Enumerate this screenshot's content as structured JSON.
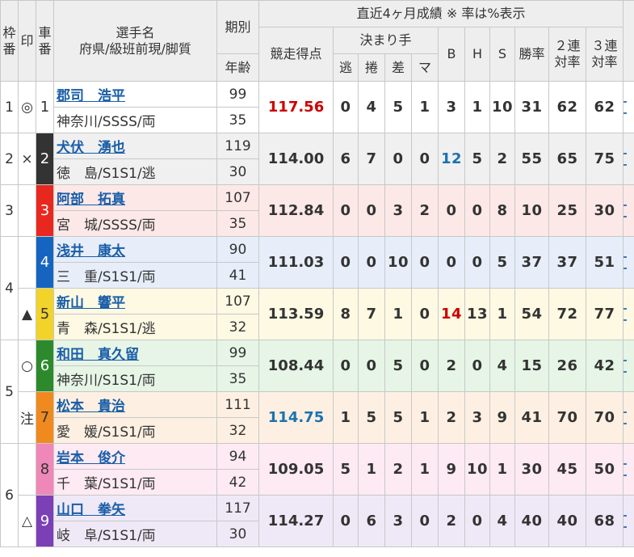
{
  "header": {
    "waku": "枠番",
    "mark": "印",
    "car": "車番",
    "name_line1": "選手名",
    "name_line2": "府県/級班前現/脚質",
    "term": "期別",
    "age": "年齢",
    "recent": "直近4ヶ月成績 ※ 率は%表示",
    "score": "競走得点",
    "kimarite": "決まり手",
    "nige": "逃",
    "makuri": "捲",
    "sashi": "差",
    "mark_col": "マ",
    "b": "B",
    "h": "H",
    "s": "S",
    "win_rate": "勝率",
    "rate2_l1": "２連",
    "rate2_l2": "対率",
    "rate3_l1": "３連",
    "rate3_l2": "対率"
  },
  "colors": {
    "row_bg": [
      "#ffffff",
      "#f0f0f0",
      "#fde8e8",
      "#e7eefa",
      "#fdf9e3",
      "#e6f5e6",
      "#fdf0e2",
      "#fdeaf3",
      "#efe9f7"
    ],
    "car_bg": [
      "#ffffff",
      "#333333",
      "#e8281e",
      "#1565c0",
      "#f2d32a",
      "#2c8a2c",
      "#f08a1e",
      "#ef88b8",
      "#7b3fb6"
    ],
    "car_fg": [
      "#333333",
      "#ffffff",
      "#ffffff",
      "#ffffff",
      "#333333",
      "#ffffff",
      "#333333",
      "#333333",
      "#ffffff"
    ],
    "score_red": "#cc0000",
    "score_blue": "#1a73b0",
    "link": "#1a5ea8"
  },
  "waku": [
    {
      "label": "1",
      "span": 1
    },
    {
      "label": "2",
      "span": 1
    },
    {
      "label": "3",
      "span": 1
    },
    {
      "label": "4",
      "span": 2
    },
    {
      "label": "5",
      "span": 2
    },
    {
      "label": "6",
      "span": 2
    }
  ],
  "riders": [
    {
      "mark": "◎",
      "car": "1",
      "name": "郡司　浩平",
      "region": "神奈川/SSSS/両",
      "term": "99",
      "age": "35",
      "score": "117.56",
      "score_color": "red",
      "nige": "0",
      "makuri": "4",
      "sashi": "5",
      "ma": "1",
      "b": "3",
      "b_color": "",
      "h": "1",
      "s": "10",
      "win": "31",
      "r2": "62",
      "r3": "62"
    },
    {
      "mark": "×",
      "car": "2",
      "name": "犬伏　湧也",
      "region": "徳　島/S1S1/逃",
      "term": "119",
      "age": "30",
      "score": "114.00",
      "score_color": "",
      "nige": "6",
      "makuri": "7",
      "sashi": "0",
      "ma": "0",
      "b": "12",
      "b_color": "blue",
      "h": "5",
      "s": "2",
      "win": "55",
      "r2": "65",
      "r3": "75"
    },
    {
      "mark": "",
      "car": "3",
      "name": "阿部　拓真",
      "region": "宮　城/SSSS/両",
      "term": "107",
      "age": "35",
      "score": "112.84",
      "score_color": "",
      "nige": "0",
      "makuri": "0",
      "sashi": "3",
      "ma": "2",
      "b": "0",
      "b_color": "",
      "h": "0",
      "s": "8",
      "win": "10",
      "r2": "25",
      "r3": "30"
    },
    {
      "mark": "",
      "car": "4",
      "name": "浅井　康太",
      "region": "三　重/S1S1/両",
      "term": "90",
      "age": "41",
      "score": "111.03",
      "score_color": "",
      "nige": "0",
      "makuri": "0",
      "sashi": "10",
      "ma": "0",
      "b": "0",
      "b_color": "",
      "h": "0",
      "s": "5",
      "win": "37",
      "r2": "37",
      "r3": "51"
    },
    {
      "mark": "▲",
      "car": "5",
      "name": "新山　響平",
      "region": "青　森/S1S1/逃",
      "term": "107",
      "age": "32",
      "score": "113.59",
      "score_color": "",
      "nige": "8",
      "makuri": "7",
      "sashi": "1",
      "ma": "0",
      "b": "14",
      "b_color": "red",
      "h": "13",
      "s": "1",
      "win": "54",
      "r2": "72",
      "r3": "77"
    },
    {
      "mark": "○",
      "car": "6",
      "name": "和田　真久留",
      "region": "神奈川/S1S1/両",
      "term": "99",
      "age": "35",
      "score": "108.44",
      "score_color": "",
      "nige": "0",
      "makuri": "0",
      "sashi": "5",
      "ma": "0",
      "b": "2",
      "b_color": "",
      "h": "0",
      "s": "4",
      "win": "15",
      "r2": "26",
      "r3": "42"
    },
    {
      "mark": "注",
      "car": "7",
      "name": "松本　貴治",
      "region": "愛　媛/S1S1/両",
      "term": "111",
      "age": "32",
      "score": "114.75",
      "score_color": "blue",
      "nige": "1",
      "makuri": "5",
      "sashi": "5",
      "ma": "1",
      "b": "2",
      "b_color": "",
      "h": "3",
      "s": "9",
      "win": "41",
      "r2": "70",
      "r3": "70"
    },
    {
      "mark": "",
      "car": "8",
      "name": "岩本　俊介",
      "region": "千　葉/S1S1/両",
      "term": "94",
      "age": "42",
      "score": "109.05",
      "score_color": "",
      "nige": "5",
      "makuri": "1",
      "sashi": "2",
      "ma": "1",
      "b": "9",
      "b_color": "",
      "h": "10",
      "s": "1",
      "win": "30",
      "r2": "45",
      "r3": "50"
    },
    {
      "mark": "△",
      "car": "9",
      "name": "山口　拳矢",
      "region": "岐　阜/S1S1/両",
      "term": "117",
      "age": "30",
      "score": "114.27",
      "score_color": "",
      "nige": "0",
      "makuri": "6",
      "sashi": "3",
      "ma": "0",
      "b": "2",
      "b_color": "",
      "h": "0",
      "s": "4",
      "win": "40",
      "r2": "40",
      "r3": "68"
    }
  ]
}
